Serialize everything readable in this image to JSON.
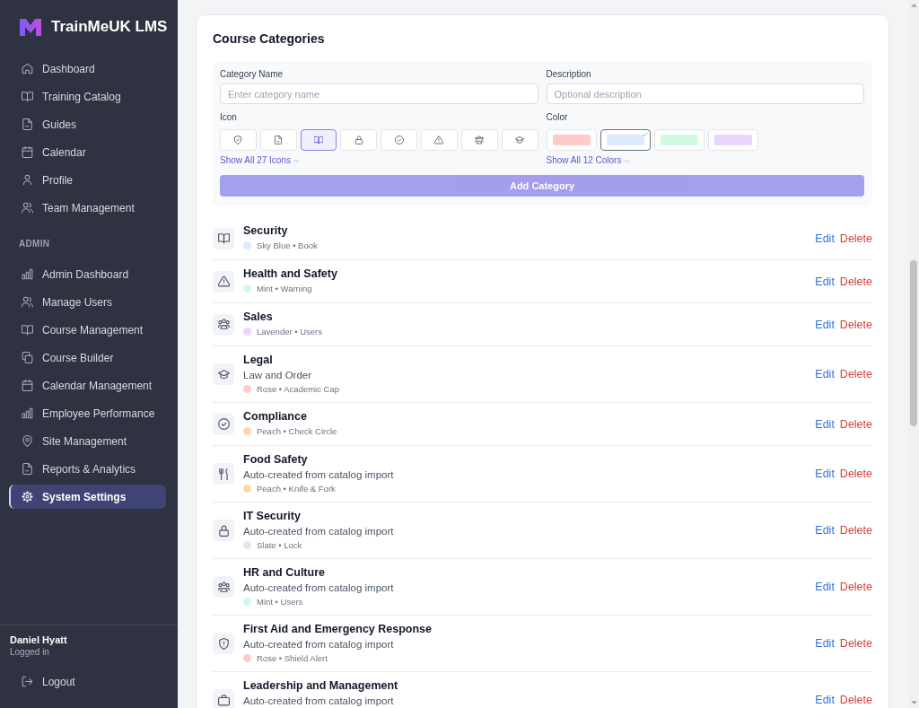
{
  "sidebar": {
    "brand": "TrainMeUK LMS",
    "nav": [
      {
        "label": "Dashboard",
        "selected": false
      },
      {
        "label": "Training Catalog",
        "selected": false
      },
      {
        "label": "Guides",
        "selected": false
      },
      {
        "label": "Calendar",
        "selected": false
      },
      {
        "label": "Profile",
        "selected": false
      },
      {
        "label": "Team Management",
        "selected": false
      }
    ],
    "admin_heading": "ADMIN",
    "admin_nav": [
      {
        "label": "Admin Dashboard",
        "selected": false
      },
      {
        "label": "Manage Users",
        "selected": false
      },
      {
        "label": "Course Management",
        "selected": false
      },
      {
        "label": "Course Builder",
        "selected": false
      },
      {
        "label": "Calendar Management",
        "selected": false
      },
      {
        "label": "Employee Performance",
        "selected": false
      },
      {
        "label": "Site Management",
        "selected": false
      },
      {
        "label": "Reports & Analytics",
        "selected": false
      },
      {
        "label": "System Settings",
        "selected": true
      }
    ],
    "user": {
      "name": "Daniel Hyatt",
      "status": "Logged in"
    },
    "logout": "Logout"
  },
  "course_categories": {
    "title": "Course Categories",
    "form": {
      "name_field": {
        "label": "Category Name",
        "placeholder": "Enter category name"
      },
      "description_field": {
        "label": "Description",
        "placeholder": "Optional description"
      },
      "icon_picker": {
        "label": "Icon",
        "options": [
          {
            "selected": false
          },
          {
            "selected": false
          },
          {
            "selected": true
          },
          {
            "selected": false
          },
          {
            "selected": false
          },
          {
            "selected": false
          },
          {
            "selected": false
          },
          {
            "selected": false
          }
        ],
        "show_all": "Show All 27 Icons"
      },
      "color_picker": {
        "label": "Color",
        "options": [
          {
            "color": "#fecaca",
            "selected": false
          },
          {
            "color": "#dbeafe",
            "selected": true
          },
          {
            "color": "#d1fae5",
            "selected": false
          },
          {
            "color": "#e9d5ff",
            "selected": false
          }
        ],
        "show_all": "Show All 12 Colors"
      },
      "submit": {
        "label": "Add Category",
        "disabled": true
      }
    },
    "categories": [
      {
        "name": "Security",
        "meta": "Sky Blue • Book",
        "color": "#dbeafe",
        "edit": "Edit",
        "delete": "Delete"
      },
      {
        "name": "Health and Safety",
        "meta": "Mint • Warning",
        "color": "#d1fae5",
        "edit": "Edit",
        "delete": "Delete"
      },
      {
        "name": "Sales",
        "meta": "Lavender • Users",
        "color": "#e9d5ff",
        "edit": "Edit",
        "delete": "Delete"
      },
      {
        "name": "Legal",
        "description": "Law and Order",
        "meta": "Rose • Academic Cap",
        "color": "#fecaca",
        "edit": "Edit",
        "delete": "Delete"
      },
      {
        "name": "Compliance",
        "meta": "Peach • Check Circle",
        "color": "#fed7aa",
        "edit": "Edit",
        "delete": "Delete"
      },
      {
        "name": "Food Safety",
        "description": "Auto-created from catalog import",
        "meta": "Peach • Knife & Fork",
        "color": "#fed7aa",
        "edit": "Edit",
        "delete": "Delete"
      },
      {
        "name": "IT Security",
        "description": "Auto-created from catalog import",
        "meta": "Slate • Lock",
        "color": "#e2e8f0",
        "edit": "Edit",
        "delete": "Delete"
      },
      {
        "name": "HR and Culture",
        "description": "Auto-created from catalog import",
        "meta": "Mint • Users",
        "color": "#d1fae5",
        "edit": "Edit",
        "delete": "Delete"
      },
      {
        "name": "First Aid and Emergency Response",
        "description": "Auto-created from catalog import",
        "meta": "Rose • Shield Alert",
        "color": "#fecaca",
        "edit": "Edit",
        "delete": "Delete"
      },
      {
        "name": "Leadership and Management",
        "description": "Auto-created from catalog import",
        "edit": "Edit",
        "delete": "Delete"
      }
    ]
  }
}
